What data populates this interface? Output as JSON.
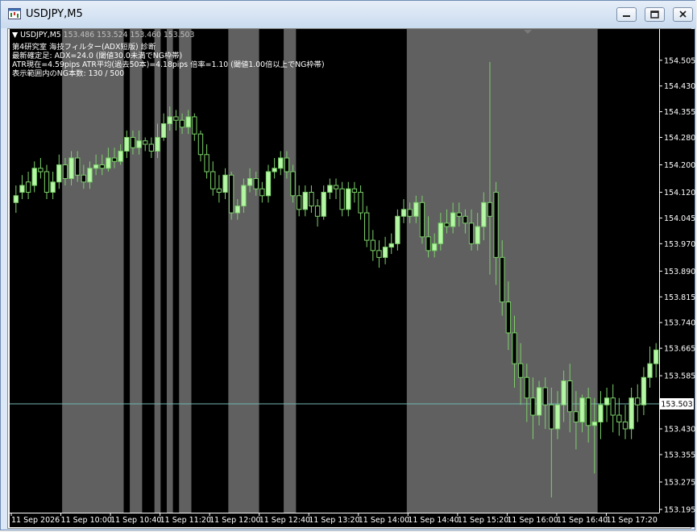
{
  "window": {
    "title": "USDJPY,M5",
    "controls": [
      "minimize",
      "maximize",
      "close"
    ]
  },
  "header": {
    "symbol": "USDJPY,M5",
    "open": "153.486",
    "high": "153.524",
    "low": "153.460",
    "close": "153.503"
  },
  "overlay_lines": [
    "第4研究室 海技フィルター(ADX短版) 診断",
    "最新確定足: ADX=24.0 (閾値30.0未満でNG枠帯)",
    "ATR現在=4.59pips  ATR平均(過去50本)=4.18pips  倍率=1.10 (閾値1.00倍以上でNG枠帯)",
    "表示範囲内のNG本数: 130 / 500"
  ],
  "current_price": "153.503",
  "colors": {
    "chart_bg": "#000000",
    "ng_band": "#606060",
    "bull_candle": "#b6f7a6",
    "bear_candle": "#000000",
    "wick": "#7cd16a",
    "price_line": "#6fb6b2",
    "text": "#ffffff"
  },
  "chart_data": {
    "type": "candlestick",
    "symbol": "USDJPY",
    "timeframe": "M5",
    "ylim": [
      153.195,
      154.535
    ],
    "y_ticks": [
      "154.505",
      "154.430",
      "154.355",
      "154.280",
      "154.200",
      "154.120",
      "154.045",
      "153.970",
      "153.890",
      "153.815",
      "153.740",
      "153.665",
      "153.585",
      "153.503",
      "153.430",
      "153.355",
      "153.275",
      "153.195"
    ],
    "x_ticks": [
      "11 Sep 2026",
      "11 Sep 10:00",
      "11 Sep 10:40",
      "11 Sep 11:20",
      "11 Sep 12:00",
      "11 Sep 12:40",
      "11 Sep 13:20",
      "11 Sep 14:00",
      "11 Sep 14:40",
      "11 Sep 15:20",
      "11 Sep 16:00",
      "11 Sep 16:40",
      "11 Sep 17:20"
    ],
    "ng_bands_bar_index": [
      [
        8,
        18
      ],
      [
        19,
        21
      ],
      [
        23,
        24
      ],
      [
        25,
        26
      ],
      [
        27,
        29
      ],
      [
        35,
        40
      ],
      [
        44,
        46
      ],
      [
        64,
        95
      ]
    ],
    "closes": [
      154.11,
      154.14,
      154.12,
      154.19,
      154.18,
      154.12,
      154.15,
      154.2,
      154.16,
      154.22,
      154.17,
      154.15,
      154.19,
      154.2,
      154.19,
      154.22,
      154.21,
      154.24,
      154.28,
      154.25,
      154.27,
      154.26,
      154.24,
      154.28,
      154.32,
      154.34,
      154.33,
      154.31,
      154.34,
      154.29,
      154.23,
      154.18,
      154.13,
      154.12,
      154.17,
      154.06,
      154.08,
      154.14,
      154.16,
      154.13,
      154.11,
      154.18,
      154.19,
      154.22,
      154.18,
      154.11,
      154.07,
      154.12,
      154.08,
      154.05,
      154.12,
      154.14,
      154.13,
      154.07,
      154.13,
      154.12,
      154.06,
      153.98,
      153.95,
      153.93,
      153.96,
      153.97,
      154.05,
      154.07,
      154.05,
      154.09,
      153.99,
      153.95,
      153.97,
      154.03,
      154.02,
      154.06,
      154.05,
      154.03,
      153.97,
      154.02,
      154.09,
      154.05,
      153.93,
      153.8,
      153.71,
      153.62,
      153.58,
      153.52,
      153.47,
      153.55,
      153.5,
      153.43,
      153.5,
      153.57,
      153.48,
      153.45,
      153.52,
      153.44,
      153.45,
      153.5,
      153.52,
      153.47,
      153.45,
      153.43,
      153.52,
      153.5,
      153.58,
      153.62,
      153.66
    ],
    "opens": [
      154.09,
      154.12,
      154.15,
      154.14,
      154.19,
      154.18,
      154.12,
      154.15,
      154.2,
      154.16,
      154.22,
      154.17,
      154.15,
      154.19,
      154.2,
      154.19,
      154.22,
      154.21,
      154.24,
      154.28,
      154.25,
      154.27,
      154.26,
      154.24,
      154.28,
      154.32,
      154.34,
      154.33,
      154.31,
      154.34,
      154.29,
      154.23,
      154.18,
      154.13,
      154.12,
      154.17,
      154.06,
      154.08,
      154.14,
      154.16,
      154.13,
      154.11,
      154.18,
      154.19,
      154.22,
      154.18,
      154.11,
      154.07,
      154.12,
      154.08,
      154.05,
      154.12,
      154.14,
      154.13,
      154.07,
      154.13,
      154.12,
      154.06,
      153.98,
      153.95,
      153.93,
      153.96,
      153.97,
      154.05,
      154.07,
      154.05,
      154.09,
      153.99,
      153.95,
      153.97,
      154.03,
      154.02,
      154.06,
      154.05,
      154.03,
      153.97,
      154.02,
      154.09,
      154.12,
      153.93,
      153.8,
      153.71,
      153.62,
      153.58,
      153.52,
      153.47,
      153.55,
      153.5,
      153.43,
      153.5,
      153.57,
      153.48,
      153.45,
      153.52,
      153.44,
      153.45,
      153.5,
      153.52,
      153.47,
      153.45,
      153.43,
      153.52,
      153.5,
      153.58,
      153.62
    ],
    "highs": [
      154.14,
      154.17,
      154.18,
      154.21,
      154.22,
      154.2,
      154.18,
      154.23,
      154.22,
      154.24,
      154.24,
      154.2,
      154.21,
      154.23,
      154.23,
      154.25,
      154.25,
      154.26,
      154.3,
      154.3,
      154.3,
      154.28,
      154.28,
      154.32,
      154.35,
      154.37,
      154.36,
      154.35,
      154.36,
      154.35,
      154.3,
      154.26,
      154.21,
      154.17,
      154.19,
      154.18,
      154.1,
      154.16,
      154.19,
      154.18,
      154.15,
      154.2,
      154.22,
      154.24,
      154.24,
      154.2,
      154.14,
      154.14,
      154.14,
      154.1,
      154.14,
      154.16,
      154.16,
      154.15,
      154.15,
      154.15,
      154.14,
      154.08,
      154.01,
      153.98,
      153.99,
      154.0,
      154.07,
      154.1,
      154.09,
      154.11,
      154.11,
      154.05,
      154.0,
      154.06,
      154.07,
      154.09,
      154.09,
      154.07,
      154.07,
      154.06,
      154.12,
      154.5,
      154.15,
      153.98,
      153.86,
      153.76,
      153.68,
      153.62,
      153.58,
      153.57,
      153.58,
      153.55,
      153.54,
      153.6,
      153.62,
      153.54,
      153.53,
      153.55,
      153.52,
      153.54,
      153.55,
      153.56,
      153.52,
      153.5,
      153.55,
      153.56,
      153.61,
      153.67,
      153.68
    ],
    "lows": [
      154.06,
      154.1,
      154.1,
      154.12,
      154.16,
      154.1,
      154.1,
      154.13,
      154.14,
      154.14,
      154.15,
      154.13,
      154.13,
      154.17,
      154.17,
      154.18,
      154.19,
      154.2,
      154.22,
      154.23,
      154.23,
      154.24,
      154.22,
      154.22,
      154.27,
      154.3,
      154.3,
      154.29,
      154.29,
      154.27,
      154.21,
      154.16,
      154.11,
      154.09,
      154.1,
      154.04,
      154.04,
      154.06,
      154.12,
      154.11,
      154.09,
      154.09,
      154.16,
      154.17,
      154.16,
      154.09,
      154.05,
      154.05,
      154.06,
      154.02,
      154.04,
      154.1,
      154.1,
      154.05,
      154.05,
      154.09,
      154.04,
      153.96,
      153.92,
      153.9,
      153.91,
      153.94,
      153.95,
      154.03,
      154.03,
      154.03,
      153.97,
      153.93,
      153.93,
      153.95,
      154.0,
      154.0,
      154.02,
      154.0,
      153.95,
      153.95,
      153.98,
      153.88,
      153.85,
      153.76,
      153.66,
      153.55,
      153.5,
      153.45,
      153.4,
      153.44,
      153.43,
      153.23,
      153.4,
      153.45,
      153.42,
      153.37,
      153.42,
      153.39,
      153.3,
      153.4,
      153.45,
      153.42,
      153.41,
      153.4,
      153.4,
      153.45,
      153.47,
      153.55,
      153.58
    ]
  }
}
